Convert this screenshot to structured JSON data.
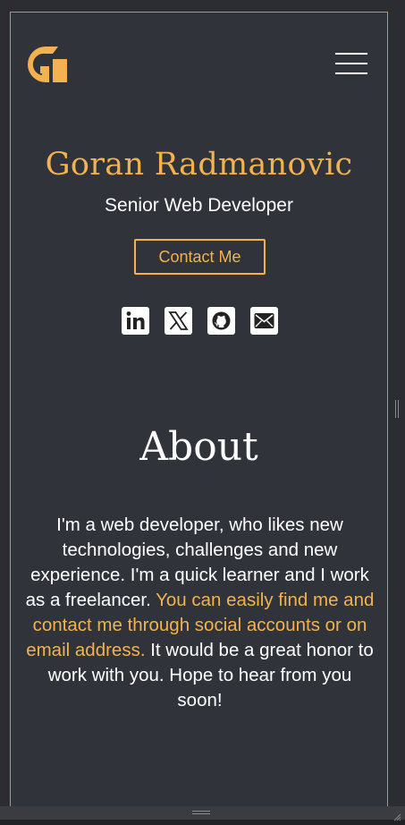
{
  "header": {
    "logo_icon": "g-letter-logo-icon",
    "menu_icon": "hamburger-menu-icon"
  },
  "hero": {
    "name": "Goran Radmanovic",
    "role": "Senior Web Developer",
    "contact_label": "Contact Me",
    "socials": [
      {
        "icon": "linkedin-icon",
        "label": "in"
      },
      {
        "icon": "x-twitter-icon",
        "label": "X"
      },
      {
        "icon": "github-icon",
        "label": "GitHub"
      },
      {
        "icon": "mail-icon",
        "label": "Email"
      }
    ]
  },
  "about": {
    "title": "About",
    "text_part1": "I'm a web developer, who likes new technologies, challenges and new experience. I'm a quick learner and I work as a freelancer. ",
    "text_highlight": "You can easily find me and contact me through social accounts or on email address.",
    "text_part2": " It would be a great honor to work with you. Hope to hear from you soon!"
  },
  "colors": {
    "accent": "#f3b24f",
    "background": "#30333a",
    "text": "#ffffff"
  }
}
